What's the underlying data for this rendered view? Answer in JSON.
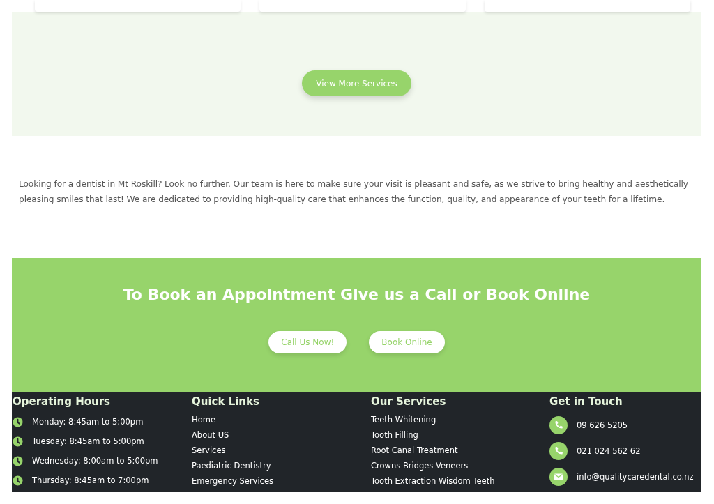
{
  "services_section": {
    "button": "View More Services"
  },
  "intro": "Looking for a dentist in Mt Roskill? Look no further. Our team is here to make sure your visit is pleasant and safe, as we strive to bring healthy and aesthetically pleasing smiles that last! We are dedicated to providing high-quality care that enhances the function, quality, and appearance of your teeth for a lifetime.",
  "booking": {
    "title": "To Book an Appointment Give us a Call or Book Online",
    "buttons": [
      "Call Us Now!",
      "Book Online"
    ]
  },
  "footer": {
    "hours": {
      "heading": "Operating Hours",
      "items": [
        "Monday: 8:45am to 5:00pm",
        "Tuesday: 8:45am to 5:00pm",
        "Wednesday: 8:00am to 5:00pm",
        "Thursday: 8:45am to 7:00pm"
      ]
    },
    "quick_links": {
      "heading": "Quick Links",
      "items": [
        "Home",
        "About US",
        "Services",
        "Paediatric Dentistry",
        "Emergency Services"
      ]
    },
    "services": {
      "heading": "Our Services",
      "items": [
        "Teeth Whitening",
        "Tooth Filling",
        "Root Canal Treatment",
        "Crowns Bridges Veneers",
        "Tooth Extraction Wisdom Teeth"
      ]
    },
    "contact": {
      "heading": "Get in Touch",
      "items": [
        {
          "kind": "phone",
          "text": "09 626 5205"
        },
        {
          "kind": "phone",
          "text": "021 024 562 62"
        },
        {
          "kind": "email",
          "text": "info@qualitycaredental.co.nz"
        }
      ]
    }
  }
}
